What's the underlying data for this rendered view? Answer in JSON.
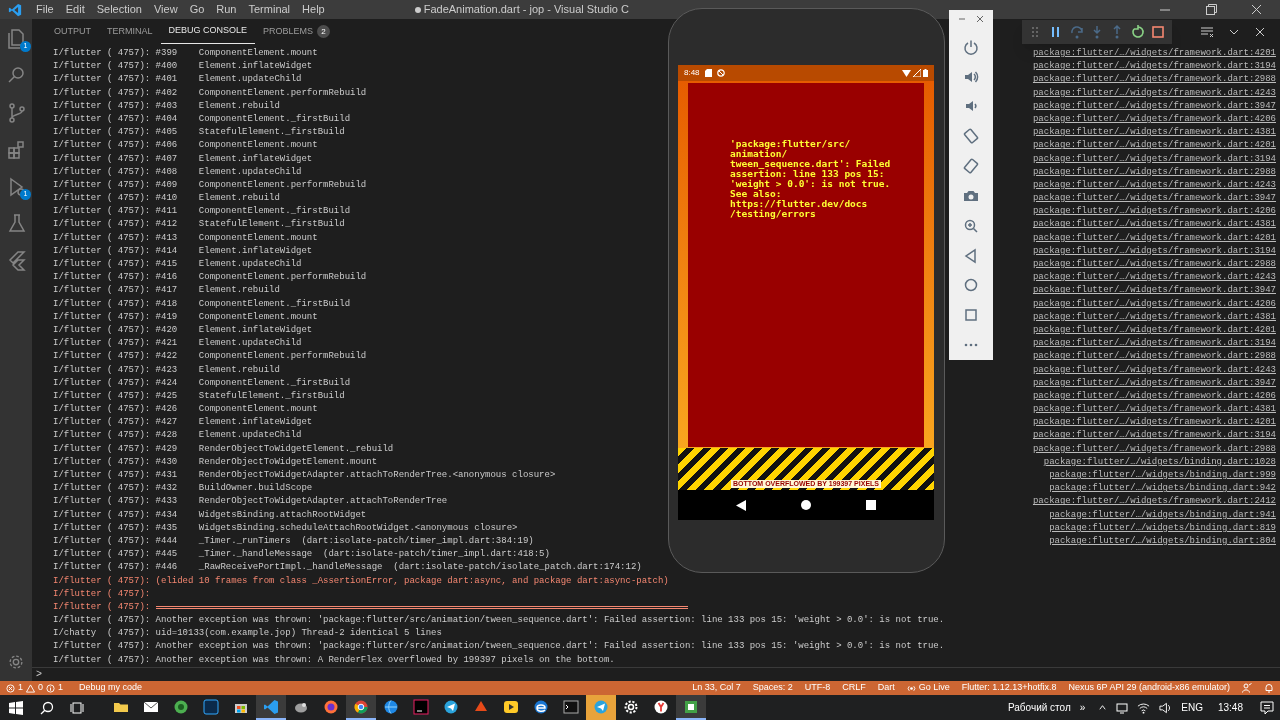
{
  "window": {
    "title": "FadeAnimation.dart - jop - Visual Studio C",
    "unsaved": true
  },
  "menu": [
    "File",
    "Edit",
    "Selection",
    "View",
    "Go",
    "Run",
    "Terminal",
    "Help"
  ],
  "activity_bar": {
    "explorer_badge": "1",
    "debug_badge": "1"
  },
  "panel": {
    "tabs": [
      {
        "label": "OUTPUT",
        "selected": false
      },
      {
        "label": "TERMINAL",
        "selected": false
      },
      {
        "label": "DEBUG CONSOLE",
        "selected": true
      },
      {
        "label": "PROBLEMS",
        "selected": false,
        "badge": "2"
      }
    ],
    "console": [
      {
        "kind": "info",
        "text": "I/flutter ( 4757): #399    ComponentElement.mount",
        "link": "package:flutter/…/widgets/framework.dart:4201"
      },
      {
        "kind": "info",
        "text": "I/flutter ( 4757): #400    Element.inflateWidget",
        "link": "package:flutter/…/widgets/framework.dart:3194"
      },
      {
        "kind": "info",
        "text": "I/flutter ( 4757): #401    Element.updateChild",
        "link": "package:flutter/…/widgets/framework.dart:2988"
      },
      {
        "kind": "info",
        "text": "I/flutter ( 4757): #402    ComponentElement.performRebuild",
        "link": "package:flutter/…/widgets/framework.dart:4243"
      },
      {
        "kind": "info",
        "text": "I/flutter ( 4757): #403    Element.rebuild",
        "link": "package:flutter/…/widgets/framework.dart:3947"
      },
      {
        "kind": "info",
        "text": "I/flutter ( 4757): #404    ComponentElement._firstBuild",
        "link": "package:flutter/…/widgets/framework.dart:4206"
      },
      {
        "kind": "info",
        "text": "I/flutter ( 4757): #405    StatefulElement._firstBuild",
        "link": "package:flutter/…/widgets/framework.dart:4381"
      },
      {
        "kind": "info",
        "text": "I/flutter ( 4757): #406    ComponentElement.mount",
        "link": "package:flutter/…/widgets/framework.dart:4201"
      },
      {
        "kind": "info",
        "text": "I/flutter ( 4757): #407    Element.inflateWidget",
        "link": "package:flutter/…/widgets/framework.dart:3194"
      },
      {
        "kind": "info",
        "text": "I/flutter ( 4757): #408    Element.updateChild",
        "link": "package:flutter/…/widgets/framework.dart:2988"
      },
      {
        "kind": "info",
        "text": "I/flutter ( 4757): #409    ComponentElement.performRebuild",
        "link": "package:flutter/…/widgets/framework.dart:4243"
      },
      {
        "kind": "info",
        "text": "I/flutter ( 4757): #410    Element.rebuild",
        "link": "package:flutter/…/widgets/framework.dart:3947"
      },
      {
        "kind": "info",
        "text": "I/flutter ( 4757): #411    ComponentElement._firstBuild",
        "link": "package:flutter/…/widgets/framework.dart:4206"
      },
      {
        "kind": "info",
        "text": "I/flutter ( 4757): #412    StatefulElement._firstBuild",
        "link": "package:flutter/…/widgets/framework.dart:4381"
      },
      {
        "kind": "info",
        "text": "I/flutter ( 4757): #413    ComponentElement.mount",
        "link": "package:flutter/…/widgets/framework.dart:4201"
      },
      {
        "kind": "info",
        "text": "I/flutter ( 4757): #414    Element.inflateWidget",
        "link": "package:flutter/…/widgets/framework.dart:3194"
      },
      {
        "kind": "info",
        "text": "I/flutter ( 4757): #415    Element.updateChild",
        "link": "package:flutter/…/widgets/framework.dart:2988"
      },
      {
        "kind": "info",
        "text": "I/flutter ( 4757): #416    ComponentElement.performRebuild",
        "link": "package:flutter/…/widgets/framework.dart:4243"
      },
      {
        "kind": "info",
        "text": "I/flutter ( 4757): #417    Element.rebuild",
        "link": "package:flutter/…/widgets/framework.dart:3947"
      },
      {
        "kind": "info",
        "text": "I/flutter ( 4757): #418    ComponentElement._firstBuild",
        "link": "package:flutter/…/widgets/framework.dart:4206"
      },
      {
        "kind": "info",
        "text": "I/flutter ( 4757): #419    ComponentElement.mount",
        "link": "package:flutter/…/widgets/framework.dart:4381"
      },
      {
        "kind": "info",
        "text": "I/flutter ( 4757): #420    Element.inflateWidget",
        "link": "package:flutter/…/widgets/framework.dart:4201"
      },
      {
        "kind": "info",
        "text": "I/flutter ( 4757): #421    Element.updateChild",
        "link": "package:flutter/…/widgets/framework.dart:3194"
      },
      {
        "kind": "info",
        "text": "I/flutter ( 4757): #422    ComponentElement.performRebuild",
        "link": "package:flutter/…/widgets/framework.dart:2988"
      },
      {
        "kind": "info",
        "text": "I/flutter ( 4757): #423    Element.rebuild",
        "link": "package:flutter/…/widgets/framework.dart:4243"
      },
      {
        "kind": "info",
        "text": "I/flutter ( 4757): #424    ComponentElement._firstBuild",
        "link": "package:flutter/…/widgets/framework.dart:3947"
      },
      {
        "kind": "info",
        "text": "I/flutter ( 4757): #425    StatefulElement._firstBuild",
        "link": "package:flutter/…/widgets/framework.dart:4206"
      },
      {
        "kind": "info",
        "text": "I/flutter ( 4757): #426    ComponentElement.mount",
        "link": "package:flutter/…/widgets/framework.dart:4381"
      },
      {
        "kind": "info",
        "text": "I/flutter ( 4757): #427    Element.inflateWidget",
        "link": "package:flutter/…/widgets/framework.dart:4201"
      },
      {
        "kind": "info",
        "text": "I/flutter ( 4757): #428    Element.updateChild",
        "link": "package:flutter/…/widgets/framework.dart:3194"
      },
      {
        "kind": "info",
        "text": "I/flutter ( 4757): #429    RenderObjectToWidgetElement._rebuild",
        "link": "package:flutter/…/widgets/framework.dart:2988"
      },
      {
        "kind": "info",
        "text": "I/flutter ( 4757): #430    RenderObjectToWidgetElement.mount",
        "link": "package:flutter/…/widgets/binding.dart:1028"
      },
      {
        "kind": "info",
        "text": "I/flutter ( 4757): #431    RenderObjectToWidgetAdapter.attachToRenderTree.<anonymous closure>",
        "link": "package:flutter/…/widgets/binding.dart:999"
      },
      {
        "kind": "info",
        "text": "I/flutter ( 4757): #432    BuildOwner.buildScope",
        "link": "package:flutter/…/widgets/binding.dart:942"
      },
      {
        "kind": "info",
        "text": "I/flutter ( 4757): #433    RenderObjectToWidgetAdapter.attachToRenderTree",
        "link": "package:flutter/…/widgets/framework.dart:2412"
      },
      {
        "kind": "info",
        "text": "I/flutter ( 4757): #434    WidgetsBinding.attachRootWidget",
        "link": "package:flutter/…/widgets/binding.dart:941"
      },
      {
        "kind": "info",
        "text": "I/flutter ( 4757): #435    WidgetsBinding.scheduleAttachRootWidget.<anonymous closure>",
        "link": "package:flutter/…/widgets/binding.dart:819"
      },
      {
        "kind": "info",
        "text": "I/flutter ( 4757): #444    _Timer._runTimers  (dart:isolate-patch/timer_impl.dart:384:19)",
        "link": "package:flutter/…/widgets/binding.dart:804"
      },
      {
        "kind": "info",
        "text": "I/flutter ( 4757): #445    _Timer._handleMessage  (dart:isolate-patch/timer_impl.dart:418:5)"
      },
      {
        "kind": "info",
        "text": "I/flutter ( 4757): #446    _RawReceivePortImpl._handleMessage  (dart:isolate-patch/isolate_patch.dart:174:12)"
      },
      {
        "kind": "error",
        "text": "I/flutter ( 4757): (elided 10 frames from class _AssertionError, package dart:async, and package dart:async-patch)"
      },
      {
        "kind": "error",
        "text": "I/flutter ( 4757):"
      },
      {
        "kind": "rule",
        "text": "I/flutter ( 4757):"
      },
      {
        "kind": "info",
        "text": "I/flutter ( 4757): Another exception was thrown: 'package:flutter/src/animation/tween_sequence.dart': Failed assertion: line 133 pos 15: 'weight > 0.0': is not true."
      },
      {
        "kind": "info",
        "text": "I/chatty  ( 4757): uid=10133(com.example.jop) Thread-2 identical 5 lines"
      },
      {
        "kind": "info",
        "text": "I/flutter ( 4757): Another exception was thrown: 'package:flutter/src/animation/tween_sequence.dart': Failed assertion: line 133 pos 15: 'weight > 0.0': is not true."
      },
      {
        "kind": "info",
        "text": "I/flutter ( 4757): Another exception was thrown: A RenderFlex overflowed by 199397 pixels on the bottom."
      }
    ],
    "prompt": ">"
  },
  "emulator": {
    "status_time": "8:48",
    "error_text": "'package:flutter/src/\nanimation/\ntween_sequence.dart': Failed\nassertion: line 133 pos 15:\n'weight > 0.0': is not true.\nSee also:\nhttps://flutter.dev/docs\n/testing/errors",
    "overflow_label": "BOTTOM OVERFLOWED BY 199397 PIXELS"
  },
  "status_bar": {
    "errors": "1",
    "warnings": "0",
    "infos": "1",
    "left": [
      "Debug my code"
    ],
    "right": [
      {
        "kind": "plain",
        "text": "Ln 33, Col 7"
      },
      {
        "kind": "plain",
        "text": "Spaces: 2"
      },
      {
        "kind": "plain",
        "text": "UTF-8"
      },
      {
        "kind": "plain",
        "text": "CRLF"
      },
      {
        "kind": "plain",
        "text": "Dart"
      },
      {
        "kind": "live",
        "text": "Go Live"
      },
      {
        "kind": "plain",
        "text": "Flutter: 1.12.13+hotfix.8"
      },
      {
        "kind": "plain",
        "text": "Nexus 6P API 29 (android-x86 emulator)"
      }
    ]
  },
  "taskbar": {
    "apps": [
      {
        "active": false,
        "attention": false
      },
      {
        "active": false,
        "attention": false
      },
      {
        "active": false,
        "attention": false
      },
      {
        "active": false,
        "attention": false
      },
      {
        "active": false,
        "attention": false
      },
      {
        "active": true,
        "attention": false
      },
      {
        "active": false,
        "attention": false
      },
      {
        "active": false,
        "attention": false
      },
      {
        "active": true,
        "attention": false
      },
      {
        "active": false,
        "attention": false
      },
      {
        "active": false,
        "attention": false
      },
      {
        "active": false,
        "attention": false
      },
      {
        "active": false,
        "attention": false
      },
      {
        "active": false,
        "attention": false
      },
      {
        "active": false,
        "attention": false
      },
      {
        "active": false,
        "attention": false
      },
      {
        "active": false,
        "attention": true
      },
      {
        "active": false,
        "attention": false
      },
      {
        "active": false,
        "attention": false
      },
      {
        "active": true,
        "attention": false
      }
    ],
    "desktop_label": "Рабочий стол",
    "overflow": "»",
    "language": "ENG",
    "time": "13:48"
  }
}
